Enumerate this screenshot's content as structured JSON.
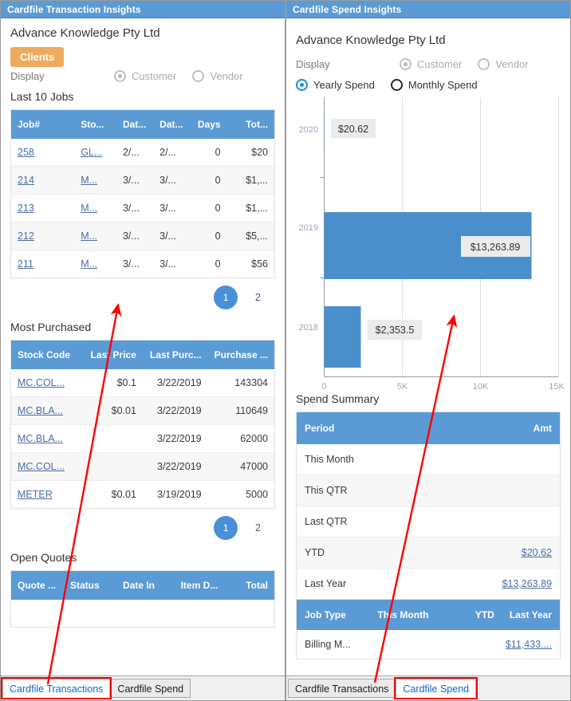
{
  "left_panel": {
    "title": "Cardfile Transaction Insights",
    "company": "Advance Knowledge Pty Ltd",
    "clients_button": "Clients",
    "display_label": "Display",
    "radios": [
      {
        "label": "Customer",
        "checked": true
      },
      {
        "label": "Vendor",
        "checked": false
      }
    ],
    "jobs": {
      "section_title": "Last 10 Jobs",
      "columns": [
        "Job#",
        "Sto...",
        "Dat...",
        "Dat...",
        "Days",
        "Tot..."
      ],
      "rows": [
        {
          "job": "258",
          "stock": "GL...",
          "date1": "2/...",
          "date2": "2/...",
          "days": "0",
          "total": "$20"
        },
        {
          "job": "214",
          "stock": "M...",
          "date1": "3/...",
          "date2": "3/...",
          "days": "0",
          "total": "$1,..."
        },
        {
          "job": "213",
          "stock": "M...",
          "date1": "3/...",
          "date2": "3/...",
          "days": "0",
          "total": "$1,..."
        },
        {
          "job": "212",
          "stock": "M...",
          "date1": "3/...",
          "date2": "3/...",
          "days": "0",
          "total": "$5,..."
        },
        {
          "job": "211",
          "stock": "M...",
          "date1": "3/...",
          "date2": "3/...",
          "days": "0",
          "total": "$56"
        }
      ],
      "pager": {
        "current": "1",
        "next": "2"
      }
    },
    "most_purchased": {
      "section_title": "Most Purchased",
      "columns": [
        "Stock Code",
        "Last Price",
        "Last Purc...",
        "Purchase ..."
      ],
      "rows": [
        {
          "code": "MC.COL...",
          "price": "$0.1",
          "last": "3/22/2019",
          "qty": "143304"
        },
        {
          "code": "MC.BLA...",
          "price": "$0.01",
          "last": "3/22/2019",
          "qty": "110649"
        },
        {
          "code": "MC.BLA...",
          "price": "",
          "last": "3/22/2019",
          "qty": "62000"
        },
        {
          "code": "MC.COL...",
          "price": "",
          "last": "3/22/2019",
          "qty": "47000"
        },
        {
          "code": "METER",
          "price": "$0.01",
          "last": "3/19/2019",
          "qty": "5000"
        }
      ],
      "pager": {
        "current": "1",
        "next": "2"
      }
    },
    "open_quotes": {
      "section_title": "Open Quotes",
      "columns": [
        "Quote ...",
        "Status",
        "Date In",
        "Item D...",
        "Total"
      ]
    },
    "tabs": [
      {
        "label": "Cardfile Transactions",
        "active": true,
        "highlighted": true
      },
      {
        "label": "Cardfile Spend",
        "active": false,
        "highlighted": false
      }
    ]
  },
  "right_panel": {
    "title": "Cardfile Spend Insights",
    "company": "Advance Knowledge Pty Ltd",
    "display_label": "Display",
    "display_radios": [
      {
        "label": "Customer",
        "checked": true
      },
      {
        "label": "Vendor",
        "checked": false
      }
    ],
    "mode_radios": [
      {
        "label": "Yearly Spend",
        "checked": true
      },
      {
        "label": "Monthly Spend",
        "checked": false
      }
    ],
    "spend_summary": {
      "section_title": "Spend Summary",
      "columns": [
        "Period",
        "Amt"
      ],
      "rows": [
        {
          "period": "This Month",
          "amt": ""
        },
        {
          "period": "This QTR",
          "amt": ""
        },
        {
          "period": "Last QTR",
          "amt": ""
        },
        {
          "period": "YTD",
          "amt": "$20.62"
        },
        {
          "period": "Last Year",
          "amt": "$13,263.89"
        }
      ]
    },
    "job_type": {
      "columns": [
        "Job Type",
        "This Month",
        "YTD",
        "Last Year"
      ],
      "rows": [
        {
          "type": "Billing M...",
          "this_month": "",
          "ytd": "",
          "last_year": "$11,433...."
        }
      ]
    },
    "tabs": [
      {
        "label": "Cardfile Transactions",
        "active": false,
        "highlighted": false
      },
      {
        "label": "Cardfile Spend",
        "active": true,
        "highlighted": true
      }
    ]
  },
  "chart_data": {
    "type": "bar",
    "orientation": "horizontal",
    "title": "",
    "categories": [
      "2020",
      "2019",
      "2018"
    ],
    "values": [
      20.62,
      13263.89,
      2353.5
    ],
    "labels": [
      "$20.62",
      "$13,263.89",
      "$2,353.5"
    ],
    "xlabel": "",
    "ylabel": "",
    "xlim": [
      0,
      15000
    ],
    "xticks": [
      0,
      5000,
      10000,
      15000
    ],
    "xticklabels": [
      "0",
      "5K",
      "10K",
      "15K"
    ],
    "grid": true,
    "legend": false,
    "bar_color": "#4a8fcb",
    "label_bg": "#ebebeb"
  },
  "colors": {
    "header_blue": "#5b9bd5",
    "accent_orange": "#eeab5e",
    "link_blue": "#4a6fa5",
    "annotation_red": "#ff0000",
    "bar_blue": "#4a8fcb"
  }
}
